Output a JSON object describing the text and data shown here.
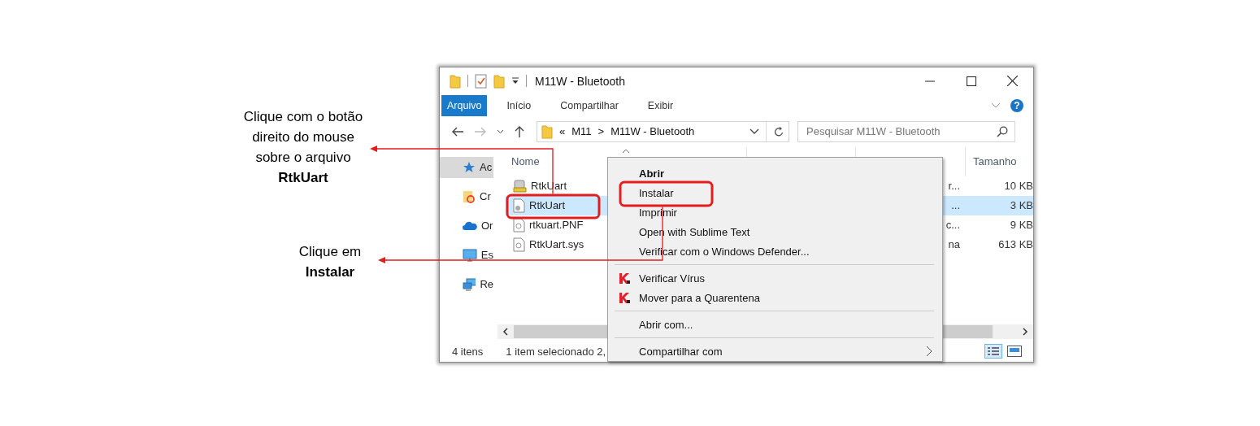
{
  "annotations": [
    {
      "text": "Clique com o botão direito do mouse sobre o arquivo **RtkUart**"
    },
    {
      "text": "Clique em **Instalar**"
    }
  ],
  "window": {
    "title": "M11W - Bluetooth",
    "help": "?"
  },
  "ribbon_tabs": [
    {
      "label": "Arquivo",
      "selected": true
    },
    {
      "label": "Início",
      "selected": false
    },
    {
      "label": "Compartilhar",
      "selected": false
    },
    {
      "label": "Exibir",
      "selected": false
    }
  ],
  "address": {
    "overflow": "«",
    "separator": ">",
    "crumbs": [
      "M11",
      "M11W - Bluetooth"
    ]
  },
  "search": {
    "placeholder": "Pesquisar M11W - Bluetooth"
  },
  "nav_pane": [
    {
      "label": "Ac",
      "kind": "star",
      "selected": true
    },
    {
      "label": "Cr",
      "kind": "cloudfolder",
      "selected": false
    },
    {
      "label": "Or",
      "kind": "cloud",
      "selected": false
    },
    {
      "label": "Es",
      "kind": "monitor",
      "selected": false
    },
    {
      "label": "Re",
      "kind": "network",
      "selected": false
    }
  ],
  "columns": [
    {
      "label": "Nome"
    },
    {
      "label": "Tamanho"
    }
  ],
  "files": [
    {
      "name": "RtkUart",
      "kind": "setup",
      "column_3": "r...",
      "size": "10 KB",
      "selected": false
    },
    {
      "name": "RtkUart",
      "kind": "config",
      "column_3": "...",
      "size": "3 KB",
      "selected": true
    },
    {
      "name": "rtkuart.PNF",
      "kind": "file",
      "column_3": "c...",
      "size": "9 KB",
      "selected": false
    },
    {
      "name": "RtkUart.sys",
      "kind": "file",
      "column_3": "na",
      "size": "613 KB",
      "selected": false
    }
  ],
  "status_bar": {
    "count": "4 itens",
    "selection": "1 item selecionado 2,"
  },
  "context_menu": [
    {
      "kind": "item",
      "label": "Abrir",
      "default": true
    },
    {
      "kind": "item",
      "label": "Instalar",
      "default": false
    },
    {
      "kind": "item",
      "label": "Imprimir",
      "default": false
    },
    {
      "kind": "item",
      "label": "Open with Sublime Text",
      "default": false
    },
    {
      "kind": "item",
      "label": "Verificar com o Windows Defender...",
      "default": false
    },
    {
      "kind": "separator"
    },
    {
      "kind": "antivirus",
      "label": "Verificar Vírus",
      "default": false
    },
    {
      "kind": "antivirus",
      "label": "Mover para a Quarentena",
      "default": false
    },
    {
      "kind": "separator"
    },
    {
      "kind": "item",
      "label": "Abrir com...",
      "default": false
    },
    {
      "kind": "separator"
    },
    {
      "kind": "submenu",
      "label": "Compartilhar com",
      "default": false
    }
  ]
}
